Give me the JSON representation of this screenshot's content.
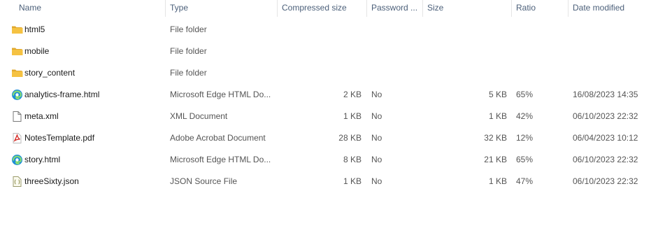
{
  "columns": {
    "name": "Name",
    "type": "Type",
    "compressed_size": "Compressed size",
    "password": "Password ...",
    "size": "Size",
    "ratio": "Ratio",
    "date_modified": "Date modified"
  },
  "rows": [
    {
      "icon": "folder-icon",
      "name": "html5",
      "type": "File folder",
      "compressed_size": "",
      "password": "",
      "size": "",
      "ratio": "",
      "date_modified": ""
    },
    {
      "icon": "folder-icon",
      "name": "mobile",
      "type": "File folder",
      "compressed_size": "",
      "password": "",
      "size": "",
      "ratio": "",
      "date_modified": ""
    },
    {
      "icon": "folder-icon",
      "name": "story_content",
      "type": "File folder",
      "compressed_size": "",
      "password": "",
      "size": "",
      "ratio": "",
      "date_modified": ""
    },
    {
      "icon": "edge-html-icon",
      "name": "analytics-frame.html",
      "type": "Microsoft Edge HTML Do...",
      "compressed_size": "2 KB",
      "password": "No",
      "size": "5 KB",
      "ratio": "65%",
      "date_modified": "16/08/2023 14:35"
    },
    {
      "icon": "xml-file-icon",
      "name": "meta.xml",
      "type": "XML Document",
      "compressed_size": "1 KB",
      "password": "No",
      "size": "1 KB",
      "ratio": "42%",
      "date_modified": "06/10/2023 22:32"
    },
    {
      "icon": "pdf-icon",
      "name": "NotesTemplate.pdf",
      "type": "Adobe Acrobat Document",
      "compressed_size": "28 KB",
      "password": "No",
      "size": "32 KB",
      "ratio": "12%",
      "date_modified": "06/04/2023 10:12"
    },
    {
      "icon": "edge-html-icon",
      "name": "story.html",
      "type": "Microsoft Edge HTML Do...",
      "compressed_size": "8 KB",
      "password": "No",
      "size": "21 KB",
      "ratio": "65%",
      "date_modified": "06/10/2023 22:32"
    },
    {
      "icon": "json-file-icon",
      "name": "threeSixty.json",
      "type": "JSON Source File",
      "compressed_size": "1 KB",
      "password": "No",
      "size": "1 KB",
      "ratio": "47%",
      "date_modified": "06/10/2023 22:32"
    }
  ],
  "colors": {
    "folder": "#f5c242",
    "edge": "#1f8fd6",
    "pdf": "#d4251f",
    "header_text": "#4c607a"
  }
}
